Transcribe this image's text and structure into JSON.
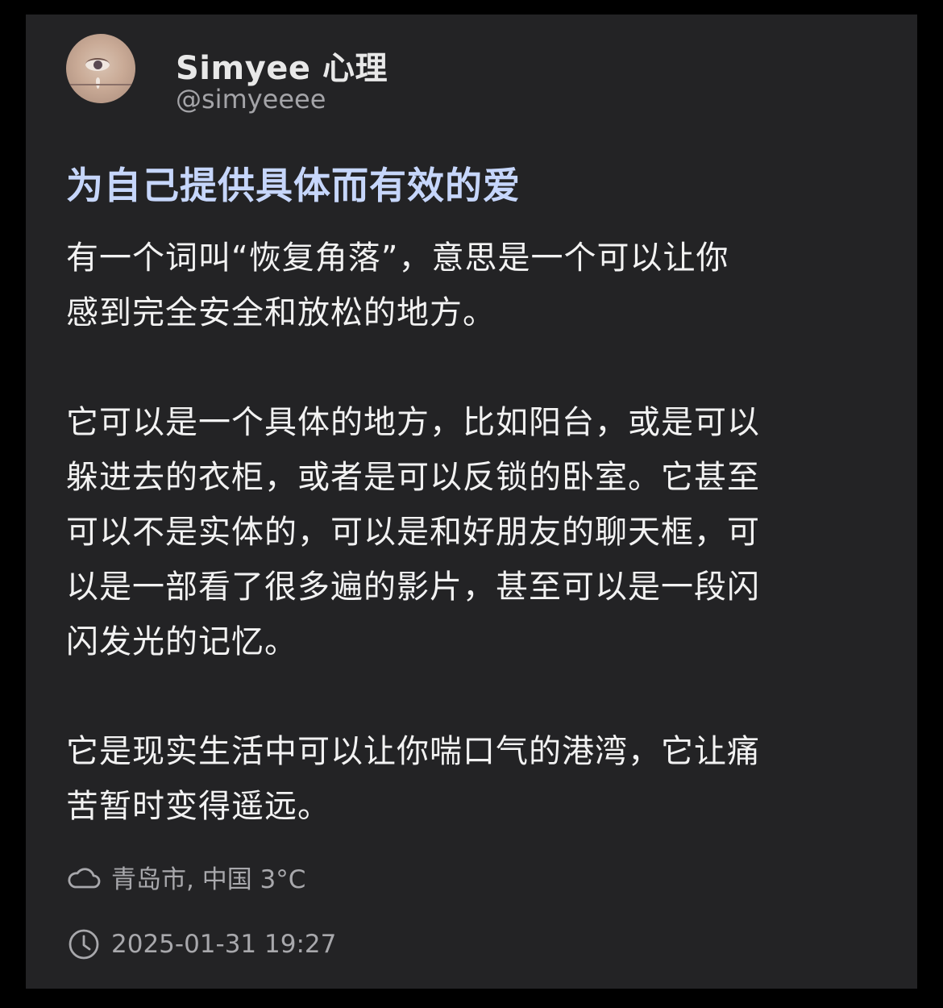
{
  "author": {
    "display_name": "Simyee 心理",
    "handle": "@simyeeee",
    "avatar_icon": "eye-avatar"
  },
  "post": {
    "title": "为自己提供具体而有效的爱",
    "paragraphs": [
      [
        "有一个词叫“恢复角落”，意思是一个可以让你",
        "感到完全安全和放松的地方。"
      ],
      [
        "它可以是一个具体的地方，比如阳台，或是可以",
        "躲进去的衣柜，或者是可以反锁的卧室。它甚至",
        "可以不是实体的，可以是和好朋友的聊天框，可",
        "以是一部看了很多遍的影片，甚至可以是一段闪",
        "闪发光的记忆。"
      ],
      [
        "它是现实生活中可以让你喘口气的港湾，它让痛",
        "苦暂时变得遥远。"
      ]
    ]
  },
  "meta": {
    "location": "青岛市, 中国 3°C",
    "location_icon": "cloud-icon",
    "timestamp": "2025-01-31 19:27",
    "timestamp_icon": "clock-icon"
  },
  "colors": {
    "background": "#000000",
    "card": "#232325",
    "title": "#c6d6fb",
    "body_text": "#f2f2f2",
    "muted": "#a8a8ac"
  }
}
